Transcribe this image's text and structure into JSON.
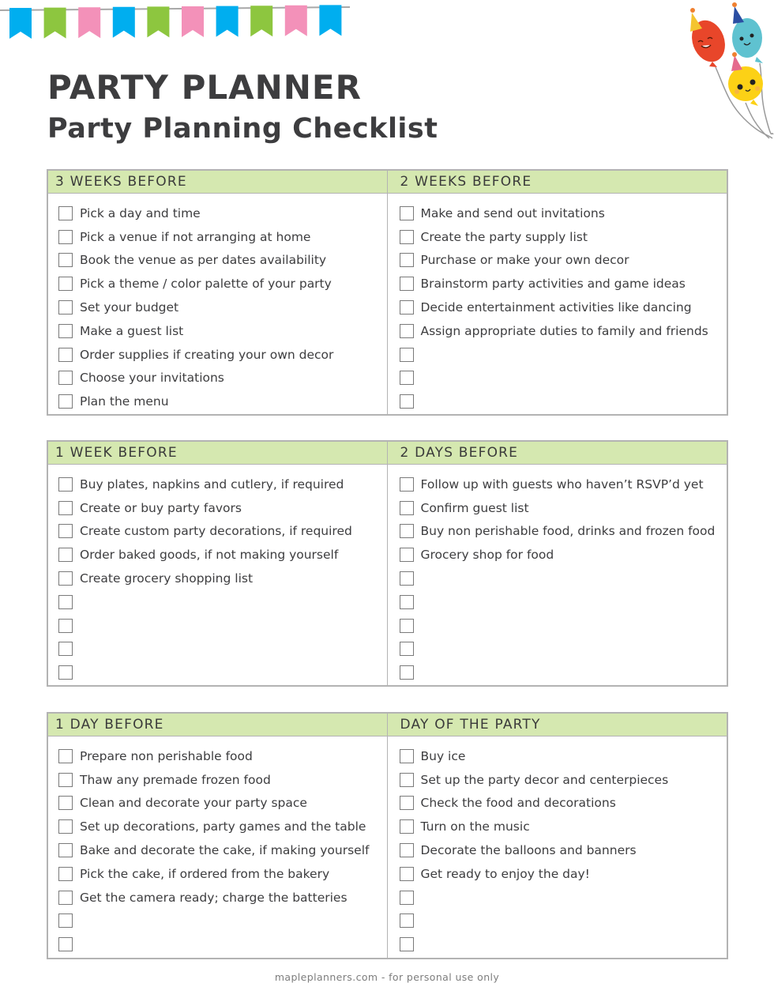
{
  "header": {
    "title": "PARTY PLANNER",
    "subtitle": "Party Planning Checklist"
  },
  "decorations": {
    "bunting_icon": "bunting-flags",
    "bunting_colors": [
      "#00aeef",
      "#8dc63f",
      "#f391b9",
      "#00aeef",
      "#8dc63f",
      "#f391b9",
      "#00aeef",
      "#8dc63f",
      "#f391b9",
      "#00aeef"
    ],
    "balloons_icon": "party-balloons",
    "balloon_colors": [
      "#e8462a",
      "#5fc2d0",
      "#fcd116"
    ]
  },
  "colors": {
    "header_bg": "#d5e8b0",
    "border": "#b3b3b3",
    "text": "#3d3d3f"
  },
  "sections": [
    {
      "left": {
        "heading": "3 WEEKS BEFORE",
        "items": [
          "Pick a day and time",
          "Pick a venue if not arranging at home",
          "Book the venue as per dates availability",
          "Pick a theme / color palette of your party",
          "Set your budget",
          "Make a guest list",
          "Order supplies if creating your own decor",
          "Choose your invitations",
          "Plan the menu"
        ]
      },
      "right": {
        "heading": "2 WEEKS BEFORE",
        "items": [
          "Make and send out invitations",
          "Create the party supply list",
          "Purchase or make your own decor",
          "Brainstorm party activities and game ideas",
          "Decide entertainment activities like dancing",
          "Assign appropriate duties to family and friends",
          "",
          "",
          ""
        ]
      }
    },
    {
      "left": {
        "heading": "1 WEEK BEFORE",
        "items": [
          "Buy plates, napkins and cutlery, if required",
          "Create or buy party favors",
          "Create custom party decorations, if required",
          "Order baked goods, if not making yourself",
          "Create grocery shopping list",
          "",
          "",
          "",
          ""
        ]
      },
      "right": {
        "heading": "2 DAYS BEFORE",
        "items": [
          "Follow up with guests who haven’t RSVP’d yet",
          "Confirm guest list",
          "Buy non perishable food, drinks and frozen food",
          "Grocery shop for food",
          "",
          "",
          "",
          "",
          ""
        ]
      }
    },
    {
      "left": {
        "heading": "1 DAY BEFORE",
        "items": [
          "Prepare non perishable food",
          "Thaw any premade frozen food",
          "Clean and decorate your party space",
          "Set up decorations, party games and the table",
          "Bake and decorate the cake, if making yourself",
          "Pick the cake, if ordered from the bakery",
          "Get the camera ready; charge the batteries",
          "",
          ""
        ]
      },
      "right": {
        "heading": "DAY OF THE PARTY",
        "items": [
          "Buy ice",
          "Set up the party decor and centerpieces",
          "Check the food and decorations",
          "Turn on the music",
          "Decorate the balloons and banners",
          "Get ready to enjoy the day!",
          "",
          "",
          ""
        ]
      }
    }
  ],
  "footer": {
    "text": "mapleplanners.com - for personal use only"
  }
}
